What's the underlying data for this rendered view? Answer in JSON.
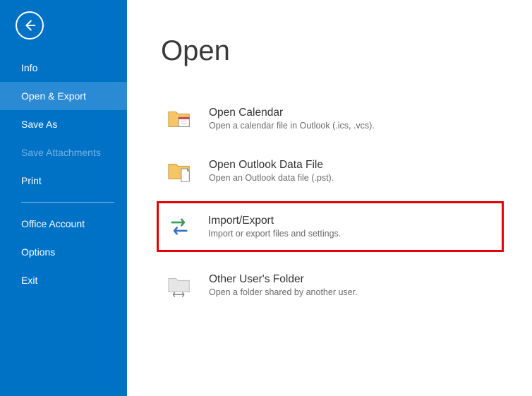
{
  "page": {
    "title": "Open"
  },
  "sidebar": {
    "items": [
      {
        "label": "Info"
      },
      {
        "label": "Open & Export"
      },
      {
        "label": "Save As"
      },
      {
        "label": "Save Attachments"
      },
      {
        "label": "Print"
      },
      {
        "label": "Office Account"
      },
      {
        "label": "Options"
      },
      {
        "label": "Exit"
      }
    ]
  },
  "options": [
    {
      "title": "Open Calendar",
      "desc": "Open a calendar file in Outlook (.ics, .vcs)."
    },
    {
      "title": "Open Outlook Data File",
      "desc": "Open an Outlook data file (.pst)."
    },
    {
      "title": "Import/Export",
      "desc": "Import or export files and settings."
    },
    {
      "title": "Other User's Folder",
      "desc": "Open a folder shared by another user."
    }
  ]
}
